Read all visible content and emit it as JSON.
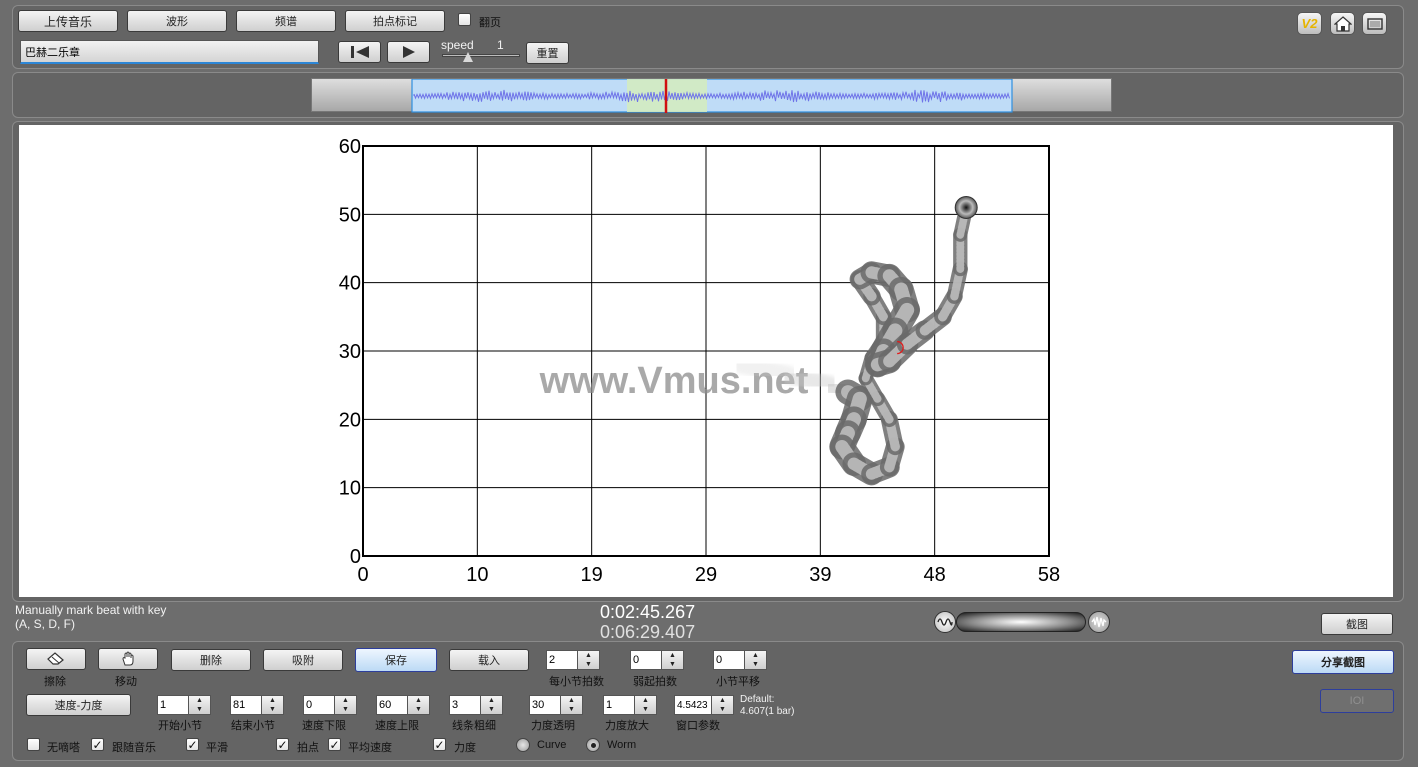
{
  "toolbar": {
    "upload_label": "上传音乐",
    "waveform_label": "波形",
    "spectrum_label": "频谱",
    "beat_mark_label": "拍点标记",
    "flip_label": "翻页",
    "flip_checked": false,
    "track_name": "巴赫二乐章",
    "speed_label": "speed",
    "speed_value": "1",
    "reset_label": "重置",
    "version_label": "V2"
  },
  "watermark": "www.Vmus.net",
  "chart_data": {
    "type": "line",
    "style": "worm",
    "x_ticks": [
      "0",
      "10",
      "19",
      "29",
      "39",
      "48",
      "58"
    ],
    "y_ticks": [
      "0",
      "10",
      "20",
      "30",
      "40",
      "50",
      "60"
    ],
    "xlim": [
      0,
      58
    ],
    "ylim": [
      0,
      60
    ],
    "grid": true,
    "series": [
      {
        "x": [
          32,
          36,
          39.5,
          41,
          42,
          41.5,
          41,
          40.5,
          41.5,
          43,
          44.5,
          45,
          44.5,
          43.5,
          42.5,
          43,
          44,
          44,
          43,
          42,
          43,
          44.5,
          45.5,
          46,
          45,
          44,
          43.5,
          44.5,
          46,
          47.5,
          49,
          50,
          50.5,
          50.5,
          51
        ],
        "y": [
          28,
          26.5,
          25,
          24,
          23,
          20,
          18,
          16,
          13.5,
          12,
          13,
          16,
          20,
          23,
          26,
          29,
          31.5,
          35,
          38,
          40.5,
          41.5,
          41,
          39,
          36,
          33,
          30,
          28,
          28.5,
          31,
          33,
          35,
          38,
          42,
          47,
          51
        ]
      }
    ],
    "current_marker": {
      "x": 45.5,
      "y": 30.5
    }
  },
  "status": {
    "hint_line1": "Manually mark beat with key",
    "hint_line2": "(A, S, D, F)",
    "current_time": "0:02:45.267",
    "total_time": "0:06:29.407",
    "screenshot_label": "截图"
  },
  "bottom": {
    "eraser_label": "擦除",
    "move_label": "移动",
    "delete_label": "删除",
    "snap_label": "吸附",
    "save_label": "保存",
    "load_label": "载入",
    "beats_per_bar_label": "每小节拍数",
    "beats_per_bar_value": "2",
    "pickup_label": "弱起拍数",
    "pickup_value": "0",
    "bar_shift_label": "小节平移",
    "bar_shift_value": "0",
    "share_label": "分享截图",
    "ioi_label": "IOI",
    "tempo_dynamics_label": "速度-力度",
    "start_bar_label": "开始小节",
    "start_bar_value": "1",
    "end_bar_label": "结束小节",
    "end_bar_value": "81",
    "tempo_min_label": "速度下限",
    "tempo_min_value": "0",
    "tempo_max_label": "速度上限",
    "tempo_max_value": "60",
    "line_width_label": "线条粗细",
    "line_width_value": "3",
    "dyn_trans_label": "力度透明",
    "dyn_trans_value": "30",
    "dyn_scale_label": "力度放大",
    "dyn_scale_value": "1",
    "window_label": "窗口参数",
    "window_value": "4.5423",
    "default_line1": "Default:",
    "default_line2": "4.607(1 bar)",
    "checks": {
      "no_click_label": "无嘀嗒",
      "no_click_checked": false,
      "follow_label": "跟随音乐",
      "follow_checked": true,
      "smooth_label": "平滑",
      "smooth_checked": true,
      "beat_label": "拍点",
      "beat_checked": true,
      "avg_label": "平均速度",
      "avg_checked": true,
      "dynamics_label": "力度",
      "dynamics_checked": true
    },
    "radios": {
      "curve_label": "Curve",
      "worm_label": "Worm",
      "selected": "Worm"
    }
  }
}
